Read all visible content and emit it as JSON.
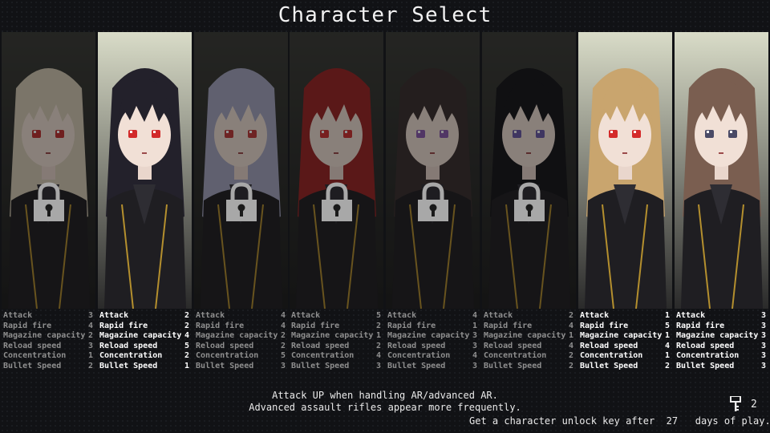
{
  "screen": {
    "title": "Character Select"
  },
  "stat_labels": [
    "Attack",
    "Rapid fire",
    "Magazine capacity",
    "Reload speed",
    "Concentration",
    "Bullet Speed"
  ],
  "characters": [
    {
      "locked": true,
      "hair": "#d8cdb6",
      "eyes": "#c23030",
      "stats": [
        "3",
        "4",
        "2",
        "3",
        "1",
        "2"
      ]
    },
    {
      "locked": false,
      "hair": "#23212b",
      "eyes": "#d22a2a",
      "stats": [
        "2",
        "2",
        "4",
        "5",
        "2",
        "1"
      ]
    },
    {
      "locked": true,
      "hair": "#a6a7c2",
      "eyes": "#c03a3a",
      "stats": [
        "4",
        "4",
        "2",
        "2",
        "5",
        "3"
      ]
    },
    {
      "locked": true,
      "hair": "#9c2424",
      "eyes": "#cf3030",
      "stats": [
        "5",
        "2",
        "1",
        "2",
        "4",
        "3"
      ]
    },
    {
      "locked": true,
      "hair": "#3a2f2f",
      "eyes": "#8b5ab0",
      "stats": [
        "4",
        "1",
        "3",
        "3",
        "4",
        "3"
      ]
    },
    {
      "locked": true,
      "hair": "#141419",
      "eyes": "#6b5aa8",
      "stats": [
        "2",
        "4",
        "1",
        "4",
        "2",
        "2"
      ]
    },
    {
      "locked": false,
      "hair": "#c9a56e",
      "eyes": "#d42a2a",
      "stats": [
        "1",
        "5",
        "1",
        "4",
        "1",
        "2"
      ]
    },
    {
      "locked": false,
      "hair": "#7a5e50",
      "eyes": "#4a4a66",
      "stats": [
        "3",
        "3",
        "3",
        "3",
        "3",
        "3"
      ]
    }
  ],
  "description": {
    "line1": "Attack UP when handling AR/advanced AR.",
    "line2": "Advanced assault rifles appear more frequently."
  },
  "unlock_message": "Get a character unlock key after  27   days of play.",
  "keys": {
    "count": "2",
    "icon": "key-icon"
  },
  "colors": {
    "background": "#111215",
    "locked_text": "#8f8f8f",
    "unlocked_text": "#ffffff",
    "lock_icon": "#a8a8a8"
  }
}
